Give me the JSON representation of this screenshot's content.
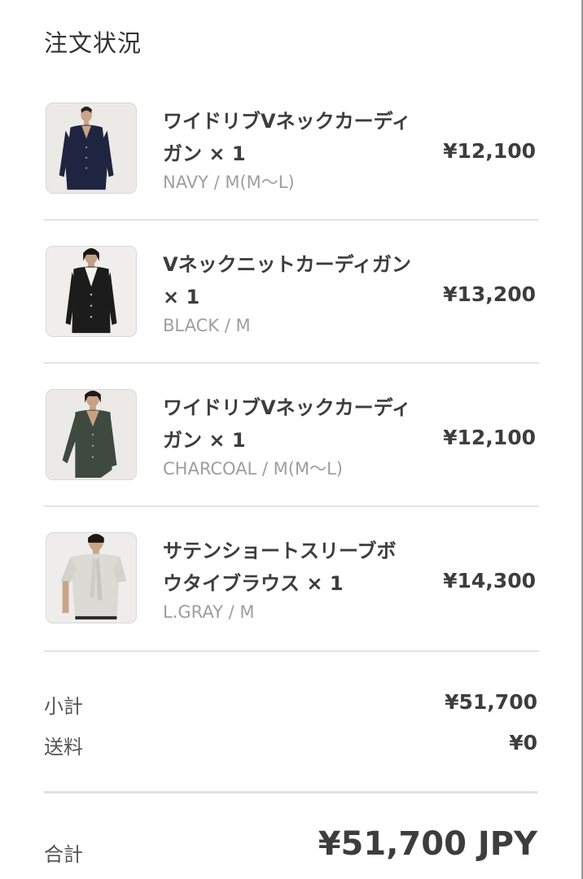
{
  "header": {
    "title": "注文状況"
  },
  "items": [
    {
      "name": "ワイドリブVネックカーディガン × 1",
      "variant": "NAVY / M(M〜L)",
      "price": "¥12,100",
      "image_icon": "navy-cardigan-photo",
      "garment_color": "#1f2540"
    },
    {
      "name": "Vネックニットカーディガン × 1",
      "variant": "BLACK / M",
      "price": "¥13,200",
      "image_icon": "black-cardigan-photo",
      "garment_color": "#1c1c1c"
    },
    {
      "name": "ワイドリブVネックカーディガン × 1",
      "variant": "CHARCOAL / M(M〜L)",
      "price": "¥12,100",
      "image_icon": "charcoal-cardigan-photo",
      "garment_color": "#3e4a40"
    },
    {
      "name": "サテンショートスリーブボウタイブラウス × 1",
      "variant": "L.GRAY / M",
      "price": "¥14,300",
      "image_icon": "gray-blouse-photo",
      "garment_color": "#dcdad5"
    }
  ],
  "summary": {
    "subtotal_label": "小計",
    "subtotal_value": "¥51,700",
    "shipping_label": "送料",
    "shipping_value": "¥0"
  },
  "total": {
    "label": "合計",
    "value": "¥51,700 JPY"
  }
}
